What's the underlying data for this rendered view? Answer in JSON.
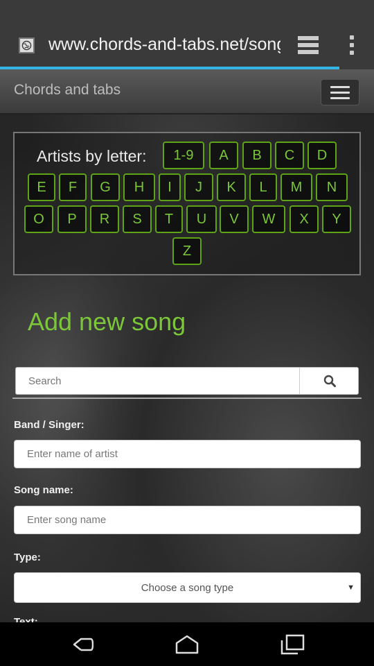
{
  "browser": {
    "url": "www.chords-and-tabs.net/song,",
    "icons": {
      "site": "globe-icon",
      "tabs": "tabs-icon",
      "menu": "overflow-menu-icon"
    },
    "progress_fraction": 0.907,
    "accent": "#33b5e5"
  },
  "site": {
    "title": "Chords and tabs",
    "menu_icon": "hamburger-icon"
  },
  "letters": {
    "label": "Artists by letter:",
    "items": [
      "1-9",
      "A",
      "B",
      "C",
      "D",
      "E",
      "F",
      "G",
      "H",
      "I",
      "J",
      "K",
      "L",
      "M",
      "N",
      "O",
      "P",
      "R",
      "S",
      "T",
      "U",
      "V",
      "W",
      "X",
      "Y",
      "Z"
    ],
    "color": "#7cc63a"
  },
  "form": {
    "title": "Add new song",
    "search": {
      "placeholder": "Search",
      "icon": "search-icon"
    },
    "band_label": "Band / Singer:",
    "band_placeholder": "Enter name of artist",
    "song_label": "Song name:",
    "song_placeholder": "Enter song name",
    "type_label": "Type:",
    "type_selected": "Choose a song type",
    "next_label": "Text:"
  },
  "navbar": {
    "icons": [
      "back-icon",
      "home-icon",
      "recents-icon"
    ]
  }
}
